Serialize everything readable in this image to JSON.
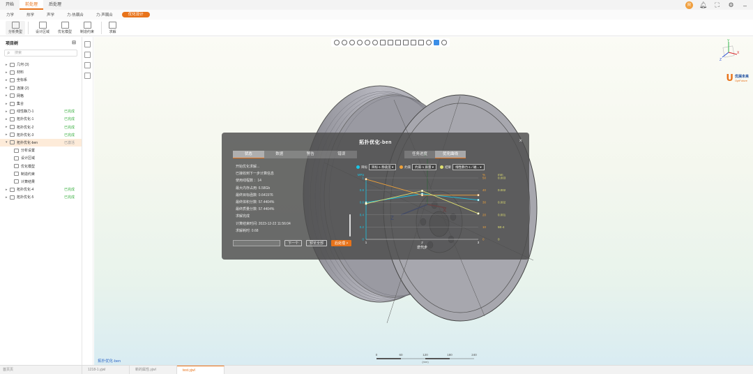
{
  "menu": {
    "items": [
      "开始",
      "前处理",
      "后处理"
    ],
    "active": 1
  },
  "subtabs": {
    "items": [
      "力学",
      "热学",
      "声学",
      "力-热耦合",
      "力-声耦合",
      "优化设计"
    ],
    "active": 5
  },
  "ribbon": {
    "buttons": [
      "分析类型",
      "设计区域",
      "优化模型",
      "制造约束",
      "求解"
    ]
  },
  "tree": {
    "title": "项目树",
    "search_placeholder": "搜索",
    "items": [
      {
        "label": "几何 (3)",
        "status": ""
      },
      {
        "label": "材料",
        "status": ""
      },
      {
        "label": "坐标系",
        "status": ""
      },
      {
        "label": "连接 (2)",
        "status": ""
      },
      {
        "label": "网格",
        "status": ""
      },
      {
        "label": "集合",
        "status": ""
      },
      {
        "label": "线性静力-1",
        "status": "已完成"
      },
      {
        "label": "拓扑优化-1",
        "status": "已完成"
      },
      {
        "label": "拓扑优化-2",
        "status": "已完成"
      },
      {
        "label": "拓扑优化-3",
        "status": "已完成"
      },
      {
        "label": "拓扑优化-ben",
        "status": "已激活"
      },
      {
        "label": "分析设置",
        "status": ""
      },
      {
        "label": "设计区域",
        "status": ""
      },
      {
        "label": "优化模型",
        "status": ""
      },
      {
        "label": "制造约束",
        "status": ""
      },
      {
        "label": "计算结果",
        "status": ""
      },
      {
        "label": "拓扑优化-4",
        "status": "已完成"
      },
      {
        "label": "拓扑优化-5",
        "status": "已完成"
      }
    ]
  },
  "viewport": {
    "label": "拓扑优化-ben",
    "scale_ticks": [
      "0",
      "60",
      "120",
      "180",
      "240"
    ],
    "scale_unit": "(mm)",
    "logo_brand": "优展未来",
    "logo_sub": "OptFuture",
    "gizmo_labels": [
      "Y",
      "X",
      "Z"
    ]
  },
  "modal": {
    "title": "拓扑优化-ben",
    "close": "×",
    "left_tabs": [
      "状态",
      "数据",
      "警告",
      "错误"
    ],
    "right_tabs": [
      "任务进度",
      "优化曲线"
    ],
    "log": [
      "开始优化求解...",
      "已接收到下一步计算信息",
      "使用线程数 ：14",
      "最大内存占用: 6.58Gb",
      "最终目标函数: 0.641976",
      "最终体积分数: 57.4404%",
      "最终质量分数: 57.4404%",
      "求解完成",
      "计算结束时间: 2023-12-22 11:56:04",
      "求解耗时: 0.68"
    ],
    "buttons": {
      "next": "下一个",
      "prev_all": "预览全部",
      "post": "后处理 >"
    },
    "selectors": [
      {
        "prefix": "目标",
        "value": "目标-1 静柔度",
        "color": "#19c6e6"
      },
      {
        "prefix": "约束",
        "value": "约束-1 质量",
        "color": "#f0a23a"
      },
      {
        "prefix": "结果",
        "value": "线性静力-1 / 磁...",
        "color": "#e0e070"
      }
    ]
  },
  "chart_data": {
    "type": "line",
    "xlabel": "迭代步",
    "x": [
      1,
      2,
      3
    ],
    "left_axis": {
      "label": "MPa",
      "ticks": [
        "1",
        "0.8",
        "0.6",
        "0.4",
        "0.2",
        "0"
      ],
      "color": "#19c6e6"
    },
    "mid_axis": {
      "label": "%",
      "ticks": [
        "50",
        "40",
        "30",
        "20",
        "10",
        "0"
      ],
      "color": "#f0a23a"
    },
    "right_axis": {
      "label": "mm",
      "ticks": [
        "0.003",
        "0.002",
        "0.002",
        "0.001",
        "5E-4",
        "0"
      ],
      "color": "#e0e070"
    },
    "series": [
      {
        "color": "#19c6e6",
        "values": [
          0.6,
          0.74,
          0.64
        ]
      },
      {
        "color": "#f0a23a",
        "values": [
          0.98,
          0.72,
          0.72
        ]
      },
      {
        "color": "#e0e070",
        "values": [
          0.58,
          0.79,
          0.42
        ]
      }
    ]
  }
}
